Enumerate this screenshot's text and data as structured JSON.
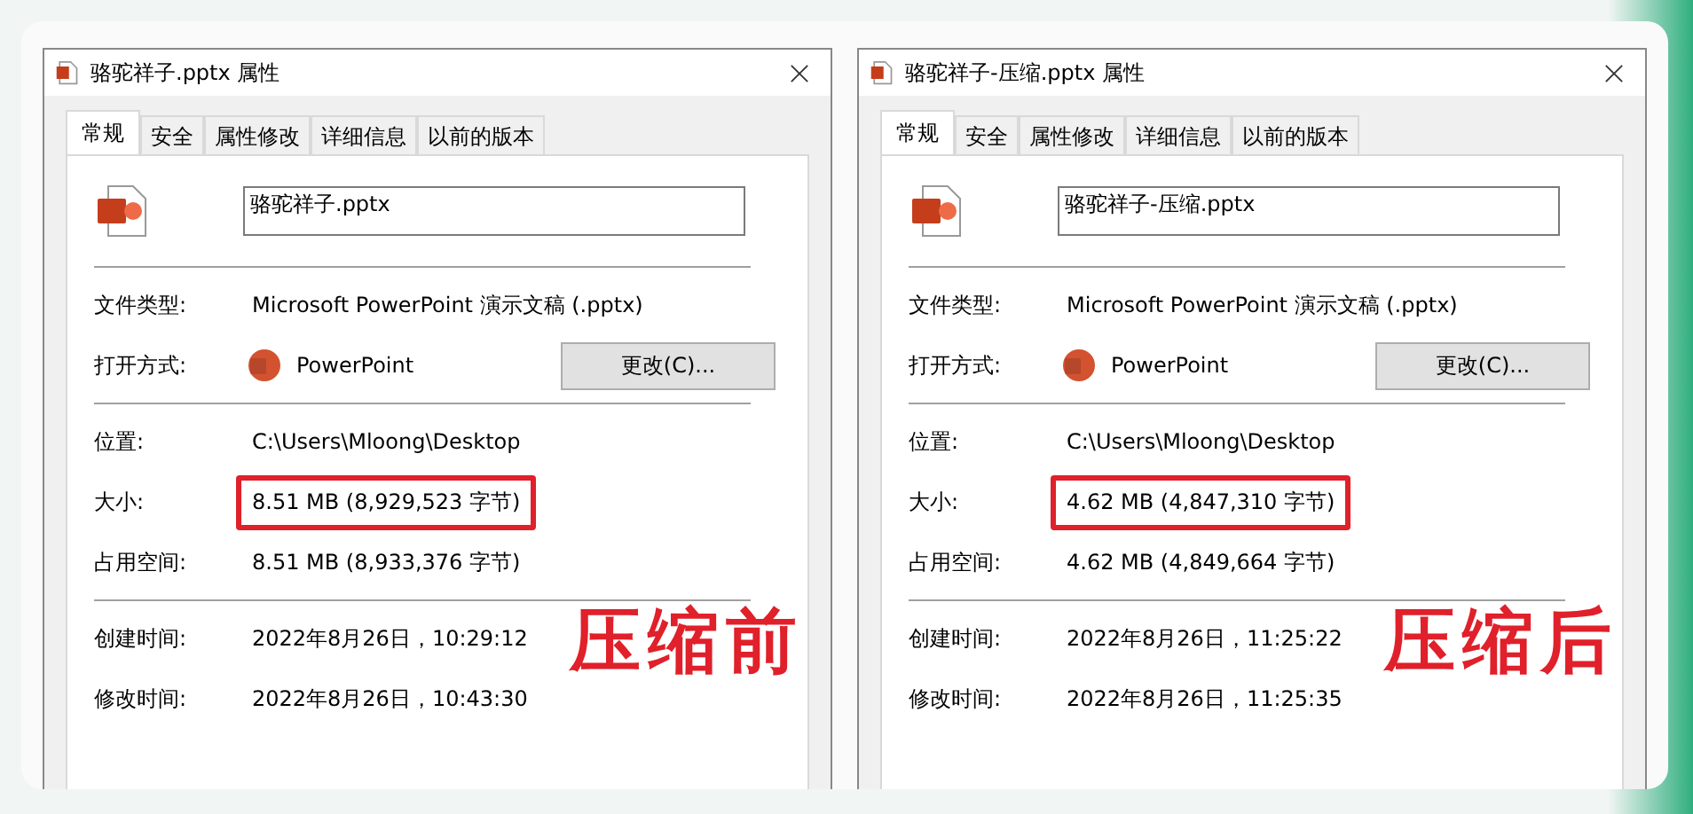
{
  "dialogs": [
    {
      "title": "骆驼祥子.pptx 属性",
      "tabs": [
        {
          "label": "常规",
          "selected": true
        },
        {
          "label": "安全",
          "selected": false
        },
        {
          "label": "属性修改",
          "selected": false
        },
        {
          "label": "详细信息",
          "selected": false
        },
        {
          "label": "以前的版本",
          "selected": false
        }
      ],
      "filename": "骆驼祥子.pptx",
      "sections": [
        [
          {
            "kind": "text",
            "label": "文件类型:",
            "value": "Microsoft PowerPoint 演示文稿 (.pptx)"
          },
          {
            "kind": "app",
            "label": "打开方式:",
            "value": "PowerPoint",
            "button": "更改(C)..."
          }
        ],
        [
          {
            "kind": "text",
            "label": "位置:",
            "value": "C:\\Users\\Mloong\\Desktop"
          },
          {
            "kind": "boxed",
            "label": "大小:",
            "value": "8.51 MB (8,929,523 字节)"
          },
          {
            "kind": "text",
            "label": "占用空间:",
            "value": "8.51 MB (8,933,376 字节)"
          }
        ],
        [
          {
            "kind": "text",
            "label": "创建时间:",
            "value": "2022年8月26日，10:29:12"
          },
          {
            "kind": "text",
            "label": "修改时间:",
            "value": "2022年8月26日，10:43:30"
          }
        ]
      ],
      "stamp": "压缩前"
    },
    {
      "title": "骆驼祥子-压缩.pptx 属性",
      "tabs": [
        {
          "label": "常规",
          "selected": true
        },
        {
          "label": "安全",
          "selected": false
        },
        {
          "label": "属性修改",
          "selected": false
        },
        {
          "label": "详细信息",
          "selected": false
        },
        {
          "label": "以前的版本",
          "selected": false
        }
      ],
      "filename": "骆驼祥子-压缩.pptx",
      "sections": [
        [
          {
            "kind": "text",
            "label": "文件类型:",
            "value": "Microsoft PowerPoint 演示文稿 (.pptx)"
          },
          {
            "kind": "app",
            "label": "打开方式:",
            "value": "PowerPoint",
            "button": "更改(C)..."
          }
        ],
        [
          {
            "kind": "text",
            "label": "位置:",
            "value": "C:\\Users\\Mloong\\Desktop"
          },
          {
            "kind": "boxed",
            "label": "大小:",
            "value": "4.62 MB (4,847,310 字节)"
          },
          {
            "kind": "text",
            "label": "占用空间:",
            "value": "4.62 MB (4,849,664 字节)"
          }
        ],
        [
          {
            "kind": "text",
            "label": "创建时间:",
            "value": "2022年8月26日，11:25:22"
          },
          {
            "kind": "text",
            "label": "修改时间:",
            "value": "2022年8月26日，11:25:35"
          }
        ]
      ],
      "stamp": "压缩后"
    }
  ]
}
